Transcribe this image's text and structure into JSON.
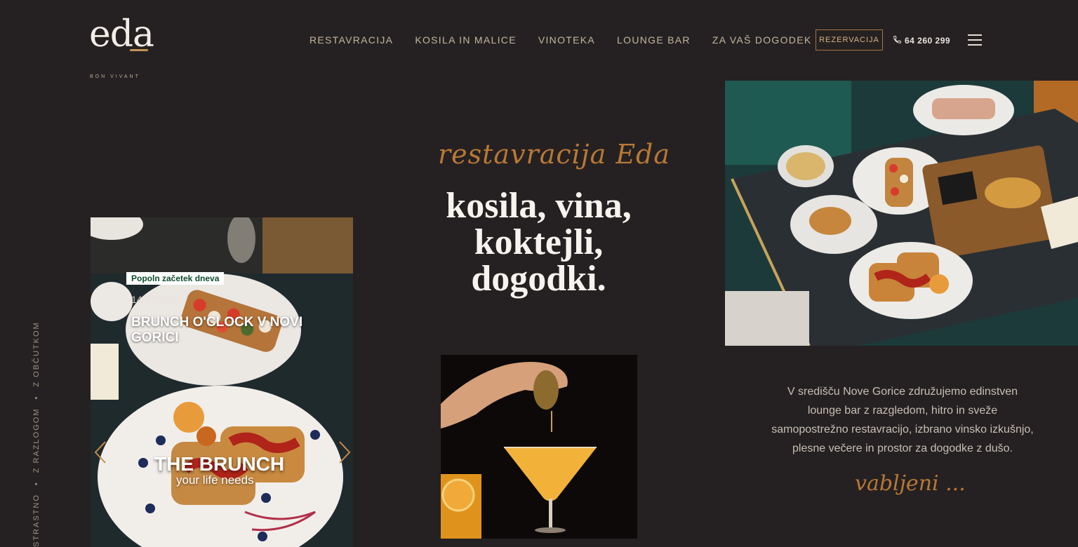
{
  "logo": {
    "mark": "eda",
    "tagline": "BON VIVANT"
  },
  "nav": {
    "items": [
      "RESTAVRACIJA",
      "KOSILA IN MALICE",
      "VINOTEKA",
      "LOUNGE BAR",
      "ZA VAŠ DOGODEK"
    ]
  },
  "header": {
    "reserve_label": "REZERVACIJA",
    "phone": "64 260 299",
    "phone_icon": "phone-icon",
    "menu_icon": "hamburger-menu-icon"
  },
  "side_text": {
    "part1": "STRASTNO",
    "part2": "Z RAZLOGOM",
    "part3": "Z OBČUTKOM",
    "separator": "•"
  },
  "hero": {
    "script": "restavracija Eda",
    "lines": [
      "kosila, vina,",
      "koktejli,",
      "dogodki."
    ]
  },
  "slider": {
    "tag": "Popoln začetek dneva",
    "date": "14/07/2025",
    "title": "BRUNCH O'CLOCK V NOVI GORICI",
    "image_headline": "THE BRUNCH",
    "image_subline": "your life needs",
    "prev_icon": "chevron-left-icon",
    "next_icon": "chevron-right-icon"
  },
  "intro": {
    "text": "V središču Nove Gorice združujemo edinstven lounge bar z razgledom, hitro in sveže samopostrežno restavracijo, izbrano vinsko izkušnjo, plesne večere in prostor za dogodke z dušo.",
    "script": "vabljeni ..."
  },
  "colors": {
    "background": "#252122",
    "accent": "#b97835",
    "nav": "#c6b59f"
  }
}
